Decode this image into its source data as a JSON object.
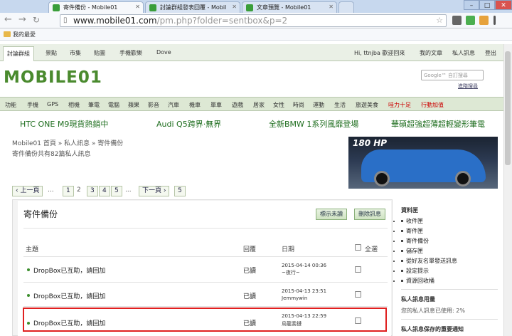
{
  "browser": {
    "tabs": [
      {
        "title": "寄件備份 - Mobile01",
        "active": true
      },
      {
        "title": "討論群組發表回覆 - Mobil",
        "active": false
      },
      {
        "title": "文章預覽 - Mobile01",
        "active": false
      }
    ],
    "url_host": "www.mobile01.com",
    "url_path": "/pm.php?folder=sentbox&p=2",
    "bookmark_folder": "我的最愛"
  },
  "sitenav": {
    "items": [
      "討論群組",
      "景點",
      "市集",
      "貼圖",
      "手機歡樂",
      "Dove"
    ],
    "user": "Hi, ttnjba 歡迎回來",
    "right": [
      "我的文章",
      "私人訊息",
      "登出"
    ]
  },
  "logo": "MOBILE01",
  "search": {
    "placeholder": "Google™ 自訂搜尋",
    "advanced": "進階搜尋"
  },
  "categories": [
    "功能",
    "手機",
    "GPS",
    "相機",
    "筆電",
    "電腦",
    "蘋果",
    "影音",
    "汽車",
    "機車",
    "單車",
    "遊戲",
    "居家",
    "女性",
    "時尚",
    "運動",
    "生活",
    "旅遊美食",
    "哇力十足",
    "行動加值"
  ],
  "category_colors": {
    "highlight": "#cc0000"
  },
  "promos": [
    "HTC ONE M9現貨熱銷中",
    "Audi Q5跨界·無界",
    "全新BMW 1系列風靡登場",
    "華碩超強超薄超輕變形筆電"
  ],
  "breadcrumb": "Mobile01 首頁 » 私人訊息 » 寄件備份",
  "count_text": "寄件備份共有82篇私人訊息",
  "ad_text": "180 HP",
  "pager": {
    "prev": "‹ 上一頁",
    "ellipsis": "...",
    "pages": [
      "1",
      "2",
      "3",
      "4",
      "5"
    ],
    "current": "2",
    "next": "下一頁 ›",
    "last": "5"
  },
  "panel": {
    "title": "寄件備份",
    "mark_unread": "標示未讀",
    "delete": "刪除訊息",
    "columns": {
      "subject": "主題",
      "reply": "回覆",
      "date": "日期",
      "select_all": "全選"
    },
    "rows": [
      {
        "subject": "DropBox已互助，請回加",
        "status": "已讀",
        "date": "2015-04-14 00:36",
        "user": "~夜行~"
      },
      {
        "subject": "DropBox已互助，請回加",
        "status": "已讀",
        "date": "2015-04-13 23:51",
        "user": "Jemmywin"
      },
      {
        "subject": "DropBox已互助，請回加",
        "status": "已讀",
        "date": "2015-04-13 22:59",
        "user": "烏龍奏鏈"
      }
    ]
  },
  "sidebar": {
    "folders_title": "資料匣",
    "folders": [
      "收件匣",
      "寄件匣",
      "寄件備份",
      "儲存匣",
      "從好友名單發送訊息",
      "設定提示",
      "資源回收桶"
    ],
    "usage_title": "私人訊息用量",
    "usage_text": "您的私人訊息已使用: 2%",
    "notice_title": "私人訊息保存的重要通知"
  }
}
